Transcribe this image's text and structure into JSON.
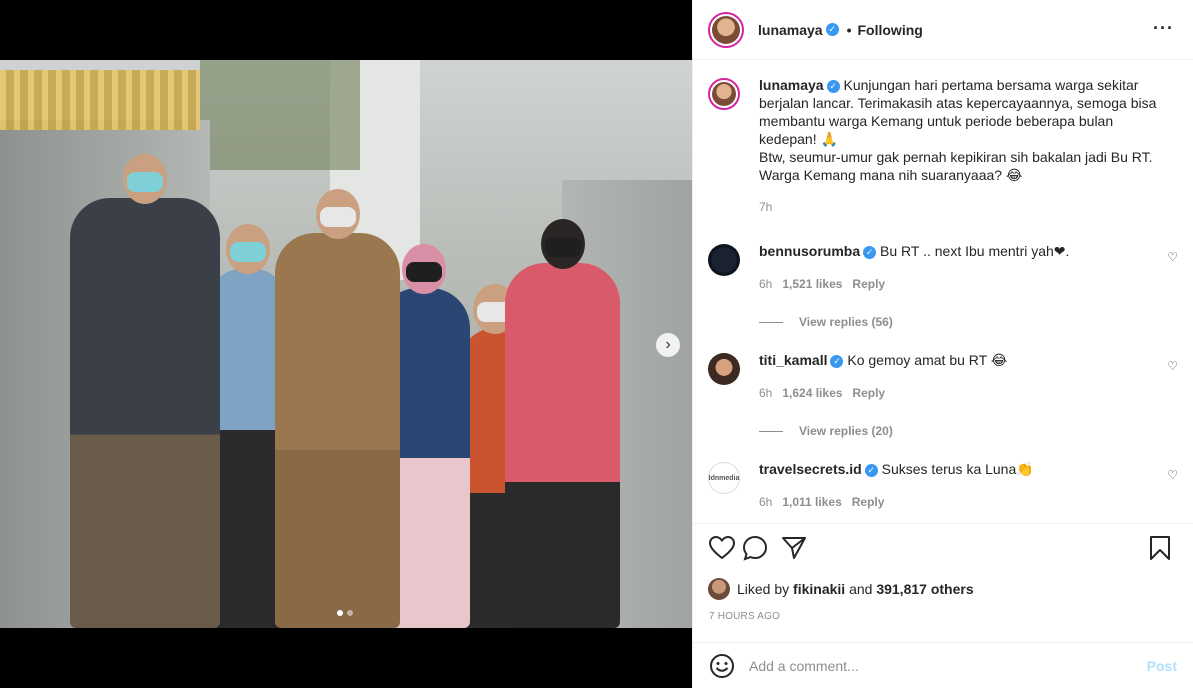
{
  "post": {
    "username": "lunamaya",
    "follow_status": "Following",
    "more_icon": "more-options-icon",
    "carousel": {
      "next_icon": "chevron-right-icon",
      "slides": 2,
      "active_slide": 1
    }
  },
  "caption": {
    "username": "lunamaya",
    "text_1": "Kunjungan hari pertama bersama warga sekitar berjalan lancar. Terimakasih atas kepercayaannya, semoga bisa membantu warga Kemang untuk periode beberapa bulan kedepan! 🙏",
    "text_2": "Btw, seumur-umur gak pernah kepikiran sih bakalan jadi Bu RT. Warga Kemang mana nih suaranyaaa? 😂",
    "time": "7h"
  },
  "comments": [
    {
      "username": "bennusorumba",
      "text": "Bu RT .. next Ibu mentri yah❤.",
      "time": "6h",
      "likes": "1,521 likes",
      "reply": "Reply",
      "view_replies": "View replies (56)"
    },
    {
      "username": "titi_kamall",
      "text": "Ko gemoy amat bu RT 😂",
      "time": "6h",
      "likes": "1,624 likes",
      "reply": "Reply",
      "view_replies": "View replies (20)"
    },
    {
      "username": "travelsecrets.id",
      "text": "Sukses terus ka Luna👏",
      "time": "6h",
      "likes": "1,011 likes",
      "reply": "Reply",
      "avatar_text": "Idnmedia"
    }
  ],
  "actions": {
    "like_icon": "heart-icon",
    "comment_icon": "comment-icon",
    "share_icon": "share-icon",
    "save_icon": "bookmark-icon"
  },
  "likes": {
    "prefix": "Liked by",
    "user": "fikinakii",
    "joiner": "and",
    "others": "391,817 others"
  },
  "timestamp": "7 HOURS AGO",
  "add_comment": {
    "placeholder": "Add a comment...",
    "post_label": "Post",
    "emoji_icon": "emoji-icon"
  },
  "colors": {
    "verified": "#3897f0",
    "post_button": "#b2dffc",
    "muted": "#8e8e8e",
    "story_ring": "#d6249f"
  }
}
